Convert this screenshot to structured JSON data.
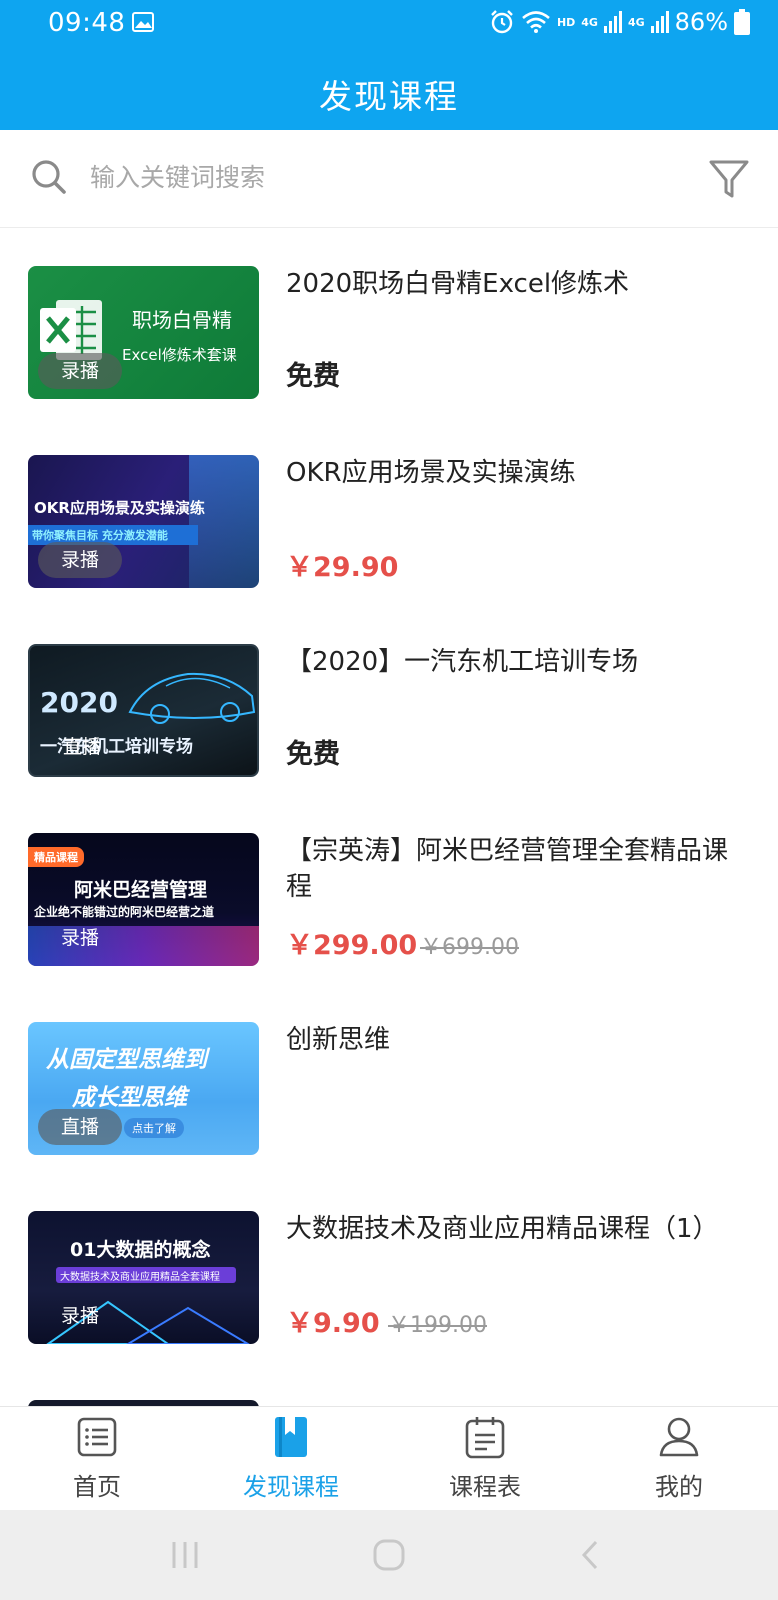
{
  "status_bar": {
    "time": "09:48",
    "hd": "HD",
    "net1": "4G",
    "net2": "4G",
    "battery": "86%"
  },
  "app_bar": {
    "title": "发现课程"
  },
  "search": {
    "placeholder": "输入关键词搜索"
  },
  "courses": [
    {
      "title": "2020职场白骨精Excel修炼术",
      "thumb_line1": "职场白骨精",
      "thumb_line2": "Excel修炼术套课",
      "badge": "录播",
      "price": "免费",
      "price_type": "free"
    },
    {
      "title": "OKR应用场景及实操演练",
      "thumb_line1": "OKR应用场景及实操演练",
      "thumb_line2": "带你聚焦目标 充分激发潜能",
      "badge": "录播",
      "price": "￥29.90",
      "price_type": "paid"
    },
    {
      "title": "【2020】一汽东机工培训专场",
      "thumb_line1": "2020",
      "thumb_line2": "一汽东机工培训专场",
      "badge": "直播",
      "price": "免费",
      "price_type": "free"
    },
    {
      "title": "【宗英涛】阿米巴经营管理全套精品课程",
      "thumb_tag": "精品课程",
      "thumb_line1": "阿米巴经营管理",
      "thumb_line2": "企业绝不能错过的阿米巴经营之道",
      "badge": "录播",
      "price": "￥299.00",
      "original_price": "￥699.00",
      "price_type": "paid"
    },
    {
      "title": "创新思维",
      "thumb_line1": "从固定型思维到",
      "thumb_line2": "成长型思维",
      "thumb_line3": "点击了解",
      "badge": "直播"
    },
    {
      "title": "大数据技术及商业应用精品课程（1）",
      "thumb_line1": "01大数据的概念",
      "thumb_line2": "大数据技术及商业应用精品全套课程",
      "badge": "录播",
      "price": "￥9.90",
      "original_price": "￥199.00",
      "price_type": "paid"
    }
  ],
  "bottom_nav": [
    {
      "label": "首页",
      "icon": "home-list-icon",
      "active": false
    },
    {
      "label": "发现课程",
      "icon": "bookmark-book-icon",
      "active": true
    },
    {
      "label": "课程表",
      "icon": "calendar-icon",
      "active": false
    },
    {
      "label": "我的",
      "icon": "user-icon",
      "active": false
    }
  ],
  "colors": {
    "primary": "#0ea5f0",
    "price_red": "#e5504a",
    "active_tab": "#1aa1e8"
  }
}
